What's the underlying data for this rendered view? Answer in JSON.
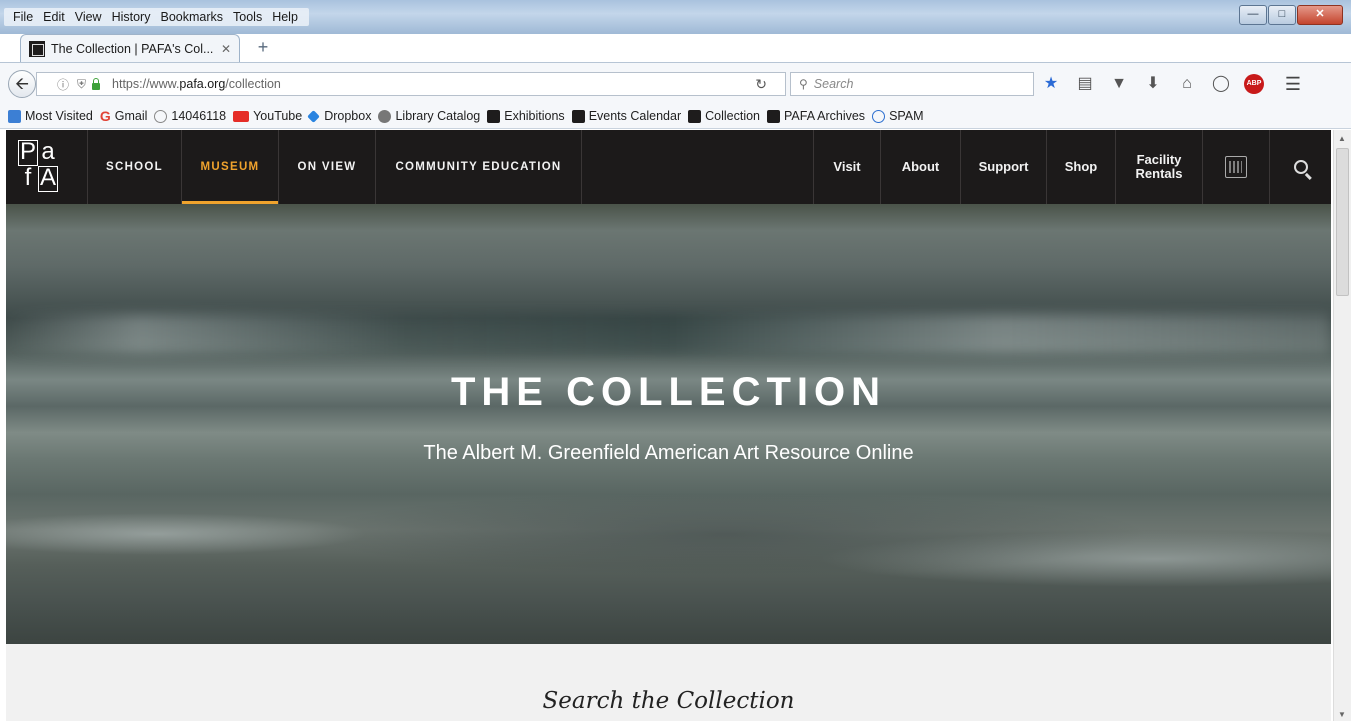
{
  "browser": {
    "menu": [
      "File",
      "Edit",
      "View",
      "History",
      "Bookmarks",
      "Tools",
      "Help"
    ],
    "tab_title": "The Collection | PAFA's Col...",
    "url_prefix": "https://www.",
    "url_domain": "pafa.org",
    "url_path": "/collection",
    "search_placeholder": "Search",
    "bookmarks": [
      "Most Visited",
      "Gmail",
      "14046118",
      "YouTube",
      "Dropbox",
      "Library Catalog",
      "Exhibitions",
      "Events Calendar",
      "Collection",
      "PAFA Archives",
      "SPAM"
    ]
  },
  "site": {
    "logo": [
      "P",
      "a",
      "f",
      "A"
    ],
    "nav_left": [
      "SCHOOL",
      "MUSEUM",
      "ON VIEW",
      "COMMUNITY EDUCATION"
    ],
    "active_nav": "MUSEUM",
    "nav_right": [
      "Visit",
      "About",
      "Support",
      "Shop"
    ],
    "facility_line1": "Facility",
    "facility_line2": "Rentals",
    "accent_color": "#f0a32d"
  },
  "hero": {
    "title": "THE COLLECTION",
    "subtitle": "The Albert M. Greenfield American Art Resource Online"
  },
  "content": {
    "search_heading": "Search the Collection"
  }
}
